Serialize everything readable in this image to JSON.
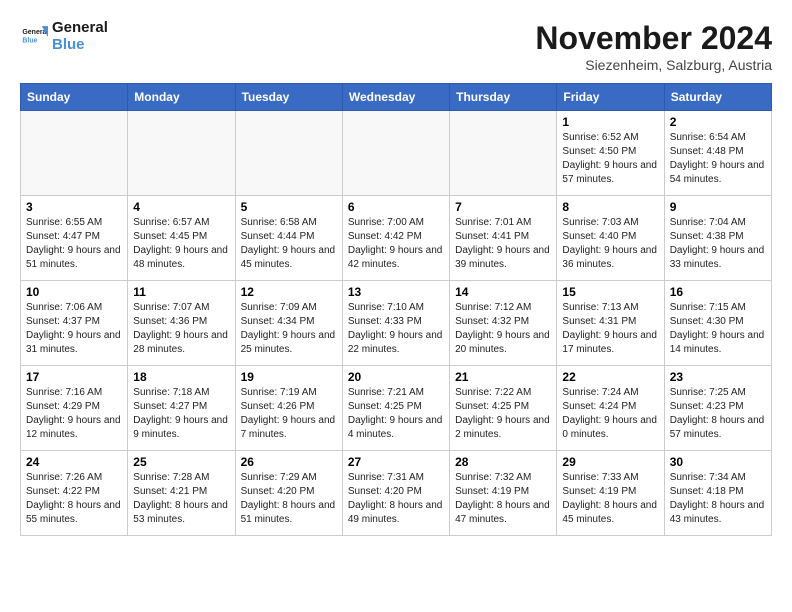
{
  "logo": {
    "line1": "General",
    "line2": "Blue"
  },
  "title": "November 2024",
  "location": "Siezenh­eim, Salzburg, Austria",
  "days_of_week": [
    "Sunday",
    "Monday",
    "Tuesday",
    "Wednesday",
    "Thursday",
    "Friday",
    "Saturday"
  ],
  "weeks": [
    [
      {
        "day": "",
        "info": ""
      },
      {
        "day": "",
        "info": ""
      },
      {
        "day": "",
        "info": ""
      },
      {
        "day": "",
        "info": ""
      },
      {
        "day": "",
        "info": ""
      },
      {
        "day": "1",
        "info": "Sunrise: 6:52 AM\nSunset: 4:50 PM\nDaylight: 9 hours and 57 minutes."
      },
      {
        "day": "2",
        "info": "Sunrise: 6:54 AM\nSunset: 4:48 PM\nDaylight: 9 hours and 54 minutes."
      }
    ],
    [
      {
        "day": "3",
        "info": "Sunrise: 6:55 AM\nSunset: 4:47 PM\nDaylight: 9 hours and 51 minutes."
      },
      {
        "day": "4",
        "info": "Sunrise: 6:57 AM\nSunset: 4:45 PM\nDaylight: 9 hours and 48 minutes."
      },
      {
        "day": "5",
        "info": "Sunrise: 6:58 AM\nSunset: 4:44 PM\nDaylight: 9 hours and 45 minutes."
      },
      {
        "day": "6",
        "info": "Sunrise: 7:00 AM\nSunset: 4:42 PM\nDaylight: 9 hours and 42 minutes."
      },
      {
        "day": "7",
        "info": "Sunrise: 7:01 AM\nSunset: 4:41 PM\nDaylight: 9 hours and 39 minutes."
      },
      {
        "day": "8",
        "info": "Sunrise: 7:03 AM\nSunset: 4:40 PM\nDaylight: 9 hours and 36 minutes."
      },
      {
        "day": "9",
        "info": "Sunrise: 7:04 AM\nSunset: 4:38 PM\nDaylight: 9 hours and 33 minutes."
      }
    ],
    [
      {
        "day": "10",
        "info": "Sunrise: 7:06 AM\nSunset: 4:37 PM\nDaylight: 9 hours and 31 minutes."
      },
      {
        "day": "11",
        "info": "Sunrise: 7:07 AM\nSunset: 4:36 PM\nDaylight: 9 hours and 28 minutes."
      },
      {
        "day": "12",
        "info": "Sunrise: 7:09 AM\nSunset: 4:34 PM\nDaylight: 9 hours and 25 minutes."
      },
      {
        "day": "13",
        "info": "Sunrise: 7:10 AM\nSunset: 4:33 PM\nDaylight: 9 hours and 22 minutes."
      },
      {
        "day": "14",
        "info": "Sunrise: 7:12 AM\nSunset: 4:32 PM\nDaylight: 9 hours and 20 minutes."
      },
      {
        "day": "15",
        "info": "Sunrise: 7:13 AM\nSunset: 4:31 PM\nDaylight: 9 hours and 17 minutes."
      },
      {
        "day": "16",
        "info": "Sunrise: 7:15 AM\nSunset: 4:30 PM\nDaylight: 9 hours and 14 minutes."
      }
    ],
    [
      {
        "day": "17",
        "info": "Sunrise: 7:16 AM\nSunset: 4:29 PM\nDaylight: 9 hours and 12 minutes."
      },
      {
        "day": "18",
        "info": "Sunrise: 7:18 AM\nSunset: 4:27 PM\nDaylight: 9 hours and 9 minutes."
      },
      {
        "day": "19",
        "info": "Sunrise: 7:19 AM\nSunset: 4:26 PM\nDaylight: 9 hours and 7 minutes."
      },
      {
        "day": "20",
        "info": "Sunrise: 7:21 AM\nSunset: 4:25 PM\nDaylight: 9 hours and 4 minutes."
      },
      {
        "day": "21",
        "info": "Sunrise: 7:22 AM\nSunset: 4:25 PM\nDaylight: 9 hours and 2 minutes."
      },
      {
        "day": "22",
        "info": "Sunrise: 7:24 AM\nSunset: 4:24 PM\nDaylight: 9 hours and 0 minutes."
      },
      {
        "day": "23",
        "info": "Sunrise: 7:25 AM\nSunset: 4:23 PM\nDaylight: 8 hours and 57 minutes."
      }
    ],
    [
      {
        "day": "24",
        "info": "Sunrise: 7:26 AM\nSunset: 4:22 PM\nDaylight: 8 hours and 55 minutes."
      },
      {
        "day": "25",
        "info": "Sunrise: 7:28 AM\nSunset: 4:21 PM\nDaylight: 8 hours and 53 minutes."
      },
      {
        "day": "26",
        "info": "Sunrise: 7:29 AM\nSunset: 4:20 PM\nDaylight: 8 hours and 51 minutes."
      },
      {
        "day": "27",
        "info": "Sunrise: 7:31 AM\nSunset: 4:20 PM\nDaylight: 8 hours and 49 minutes."
      },
      {
        "day": "28",
        "info": "Sunrise: 7:32 AM\nSunset: 4:19 PM\nDaylight: 8 hours and 47 minutes."
      },
      {
        "day": "29",
        "info": "Sunrise: 7:33 AM\nSunset: 4:19 PM\nDaylight: 8 hours and 45 minutes."
      },
      {
        "day": "30",
        "info": "Sunrise: 7:34 AM\nSunset: 4:18 PM\nDaylight: 8 hours and 43 minutes."
      }
    ]
  ]
}
